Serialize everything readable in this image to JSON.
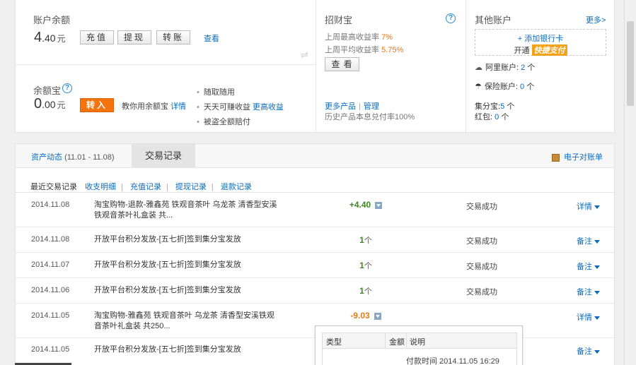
{
  "balance": {
    "title": "账户余额",
    "amount_int": "4",
    "amount_dec": ".40",
    "currency": "元",
    "buttons": [
      "充值",
      "提现",
      "转账"
    ],
    "view_link": "查看"
  },
  "yuebao": {
    "title": "余额宝",
    "amount_int": "0",
    "amount_dec": ".00",
    "currency": "元",
    "transfer_btn": "转入",
    "tip": "教你用余额宝",
    "tip_link": "详情",
    "features": [
      "随取随用",
      "天天可赚收益",
      "被盗全额赔付"
    ],
    "feature_link": "更高收益"
  },
  "zhaocaibao": {
    "title": "招财宝",
    "rate_high_label": "上周最高收益率",
    "rate_high": "7%",
    "rate_avg_label": "上周平均收益率",
    "rate_avg": "5.75%",
    "view_btn": "查 看",
    "more_products": "更多产品",
    "manage": "管理",
    "history": "历史产品本息兑付率100%"
  },
  "other_accounts": {
    "title": "其他账户",
    "more_link": "更多>",
    "add_bank": "+ 添加银行卡",
    "open_text": "开通",
    "quickpay": "快捷支付",
    "aliyun_label": "阿里账户:",
    "aliyun_count": "2",
    "insurance_label": "保险账户:",
    "insurance_count": "0",
    "ge_unit": "个",
    "jifen_label": "集分宝:",
    "jifen_count": "5",
    "hongbao_label": "红包:",
    "hongbao_count": "0"
  },
  "tabs": {
    "asset_label": "资产动态",
    "asset_range": "(11.01 - 11.08)",
    "active": "交易记录",
    "statement": "电子对账单"
  },
  "subnav": {
    "label": "最近交易记录",
    "links": [
      "收支明细",
      "充值记录",
      "提现记录",
      "退款记录"
    ]
  },
  "records": [
    {
      "date": "2014.11.08",
      "desc": "淘宝购物-退款-雅鑫苑 铁观音茶叶 乌龙茶 清香型安溪铁观音茶叶礼盒装 共...",
      "amount": "+4.40",
      "unit": "",
      "type": "pos",
      "status": "交易成功",
      "action": "详情",
      "expand": true
    },
    {
      "date": "2014.11.08",
      "desc": "开放平台积分发放-[五七折]签到集分宝发放",
      "amount": "1",
      "unit": "个",
      "type": "pts",
      "status": "交易成功",
      "action": "备注",
      "expand": false
    },
    {
      "date": "2014.11.07",
      "desc": "开放平台积分发放-[五七折]签到集分宝发放",
      "amount": "1",
      "unit": "个",
      "type": "pts",
      "status": "交易成功",
      "action": "备注",
      "expand": false
    },
    {
      "date": "2014.11.06",
      "desc": "开放平台积分发放-[五七折]签到集分宝发放",
      "amount": "1",
      "unit": "个",
      "type": "pts",
      "status": "交易成功",
      "action": "备注",
      "expand": false
    },
    {
      "date": "2014.11.05",
      "desc": "淘宝购物-雅鑫苑 铁观音茶叶 乌龙茶 清香型安溪铁观音茶叶礼盒装 共250...",
      "amount": "-9.03",
      "unit": "",
      "type": "neg",
      "status": "",
      "action": "详情",
      "expand": true
    },
    {
      "date": "2014.11.05",
      "desc": "开放平台积分发放-[五七折]签到集分宝发放",
      "amount": "",
      "unit": "",
      "type": "pts",
      "status": "",
      "action": "备注",
      "expand": false
    }
  ],
  "popup": {
    "col_type": "类型",
    "col_amount": "金额",
    "col_note": "说明",
    "pay_time": "付款时间 2014.11.05 16:29"
  }
}
